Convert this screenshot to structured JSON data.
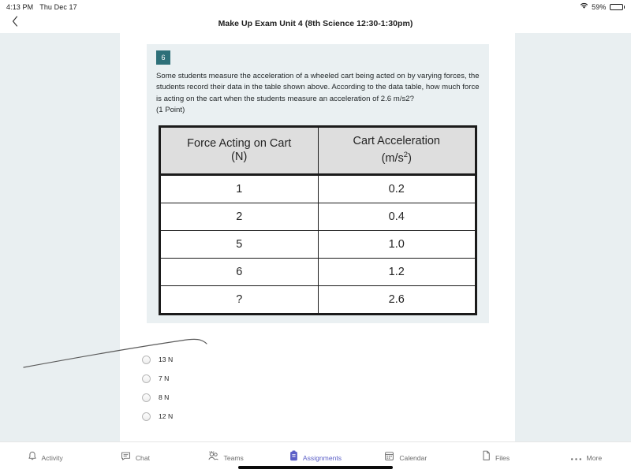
{
  "status_bar": {
    "time": "4:13 PM",
    "date": "Thu Dec 17",
    "wifi_icon": "wifi-icon",
    "battery_percent": "59%",
    "battery_level": 59
  },
  "header": {
    "back_icon": "chevron-left-icon",
    "title": "Make Up Exam Unit 4 (8th Science 12:30-1:30pm)"
  },
  "question": {
    "number": "6",
    "text": "Some students measure the acceleration of a wheeled cart being acted on by varying forces, the students record their data in the table shown above. According to the data table, how much force is acting on the cart when the students measure an acceleration of 2.6 m/s2?",
    "points": "(1 Point)",
    "badge_color": "#2e7079",
    "block_background": "#eaf0f2"
  },
  "data_table": {
    "headers": [
      {
        "line1": "Force Acting on Cart",
        "line2": "(N)",
        "sup": ""
      },
      {
        "line1": "Cart Acceleration",
        "line2": "(m/s",
        "sup": "2"
      }
    ],
    "rows": [
      {
        "force": "1",
        "acceleration": "0.2"
      },
      {
        "force": "2",
        "acceleration": "0.4"
      },
      {
        "force": "5",
        "acceleration": "1.0"
      },
      {
        "force": "6",
        "acceleration": "1.2"
      },
      {
        "force": "?",
        "acceleration": "2.6"
      }
    ]
  },
  "options": [
    {
      "label": "13 N",
      "selected": false
    },
    {
      "label": "7 N",
      "selected": false
    },
    {
      "label": "8 N",
      "selected": false
    },
    {
      "label": "12 N",
      "selected": false
    }
  ],
  "annotation": {
    "type": "ink-stroke",
    "color": "#5a5a5a"
  },
  "tabbar": {
    "active_color": "#5b5fc7",
    "inactive_color": "#6b6b6b",
    "items": [
      {
        "label": "Activity",
        "icon": "bell-icon",
        "active": false
      },
      {
        "label": "Chat",
        "icon": "chat-bubble-icon",
        "active": false
      },
      {
        "label": "Teams",
        "icon": "people-icon",
        "active": false
      },
      {
        "label": "Assignments",
        "icon": "clipboard-icon",
        "active": true
      },
      {
        "label": "Calendar",
        "icon": "calendar-icon",
        "active": false
      },
      {
        "label": "Files",
        "icon": "file-icon",
        "active": false
      },
      {
        "label": "More",
        "icon": "ellipsis-icon",
        "active": false
      }
    ]
  }
}
